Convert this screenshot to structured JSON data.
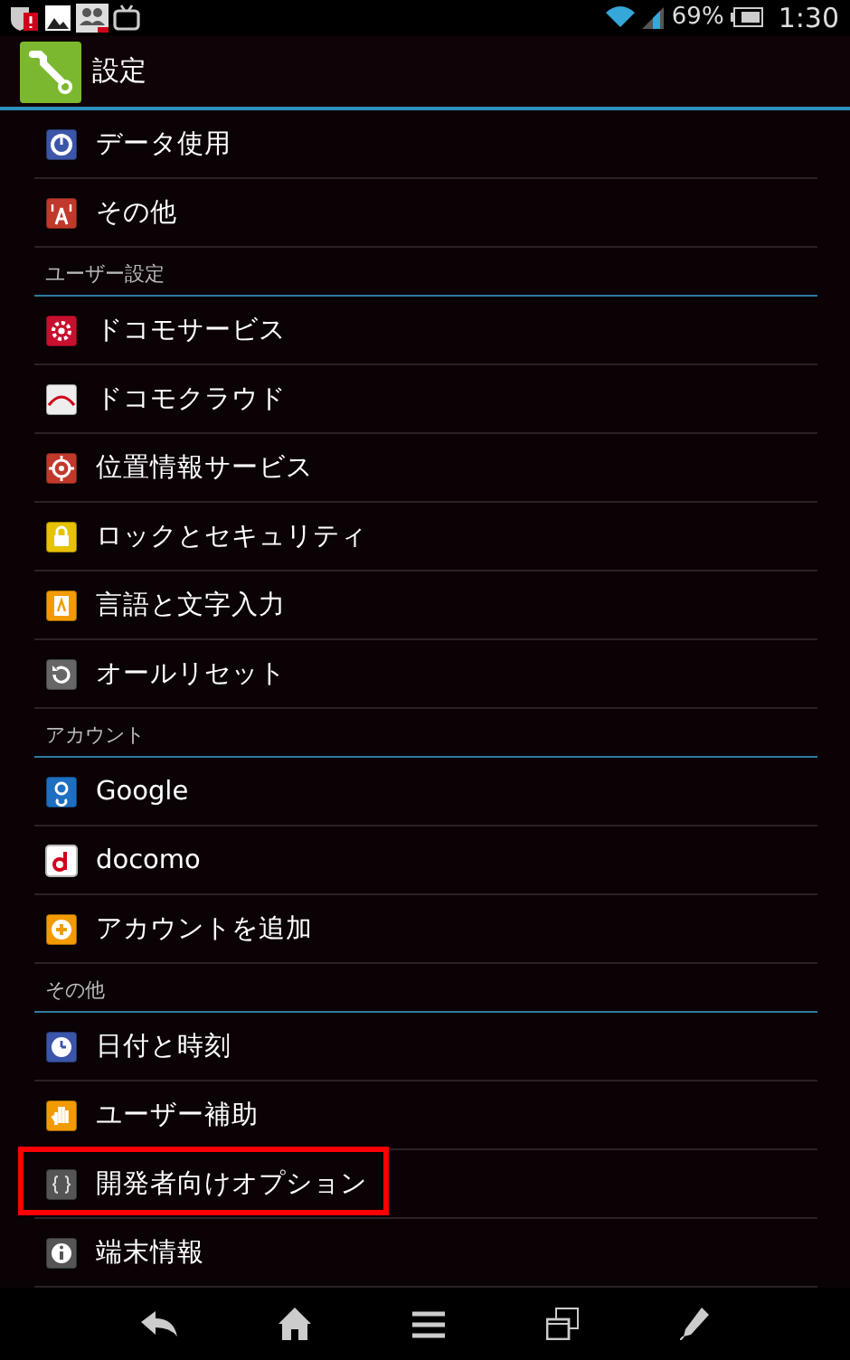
{
  "status_bar": {
    "battery_text": "69%",
    "time": "1:30"
  },
  "action_bar": {
    "title": "設定"
  },
  "sections": [
    {
      "items": [
        {
          "label": "データ使用",
          "highlighted": false
        },
        {
          "label": "その他",
          "highlighted": false
        }
      ]
    },
    {
      "header": "ユーザー設定",
      "items": [
        {
          "label": "ドコモサービス",
          "highlighted": false
        },
        {
          "label": "ドコモクラウド",
          "highlighted": false
        },
        {
          "label": "位置情報サービス",
          "highlighted": false
        },
        {
          "label": "ロックとセキュリティ",
          "highlighted": false
        },
        {
          "label": "言語と文字入力",
          "highlighted": false
        },
        {
          "label": "オールリセット",
          "highlighted": false
        }
      ]
    },
    {
      "header": "アカウント",
      "items": [
        {
          "label": "Google",
          "highlighted": false
        },
        {
          "label": "docomo",
          "highlighted": false
        },
        {
          "label": "アカウントを追加",
          "highlighted": false
        }
      ]
    },
    {
      "header": "その他",
      "items": [
        {
          "label": "日付と時刻",
          "highlighted": false
        },
        {
          "label": "ユーザー補助",
          "highlighted": false
        },
        {
          "label": "開発者向けオプション",
          "highlighted": true
        },
        {
          "label": "端末情報",
          "highlighted": false
        }
      ]
    }
  ]
}
